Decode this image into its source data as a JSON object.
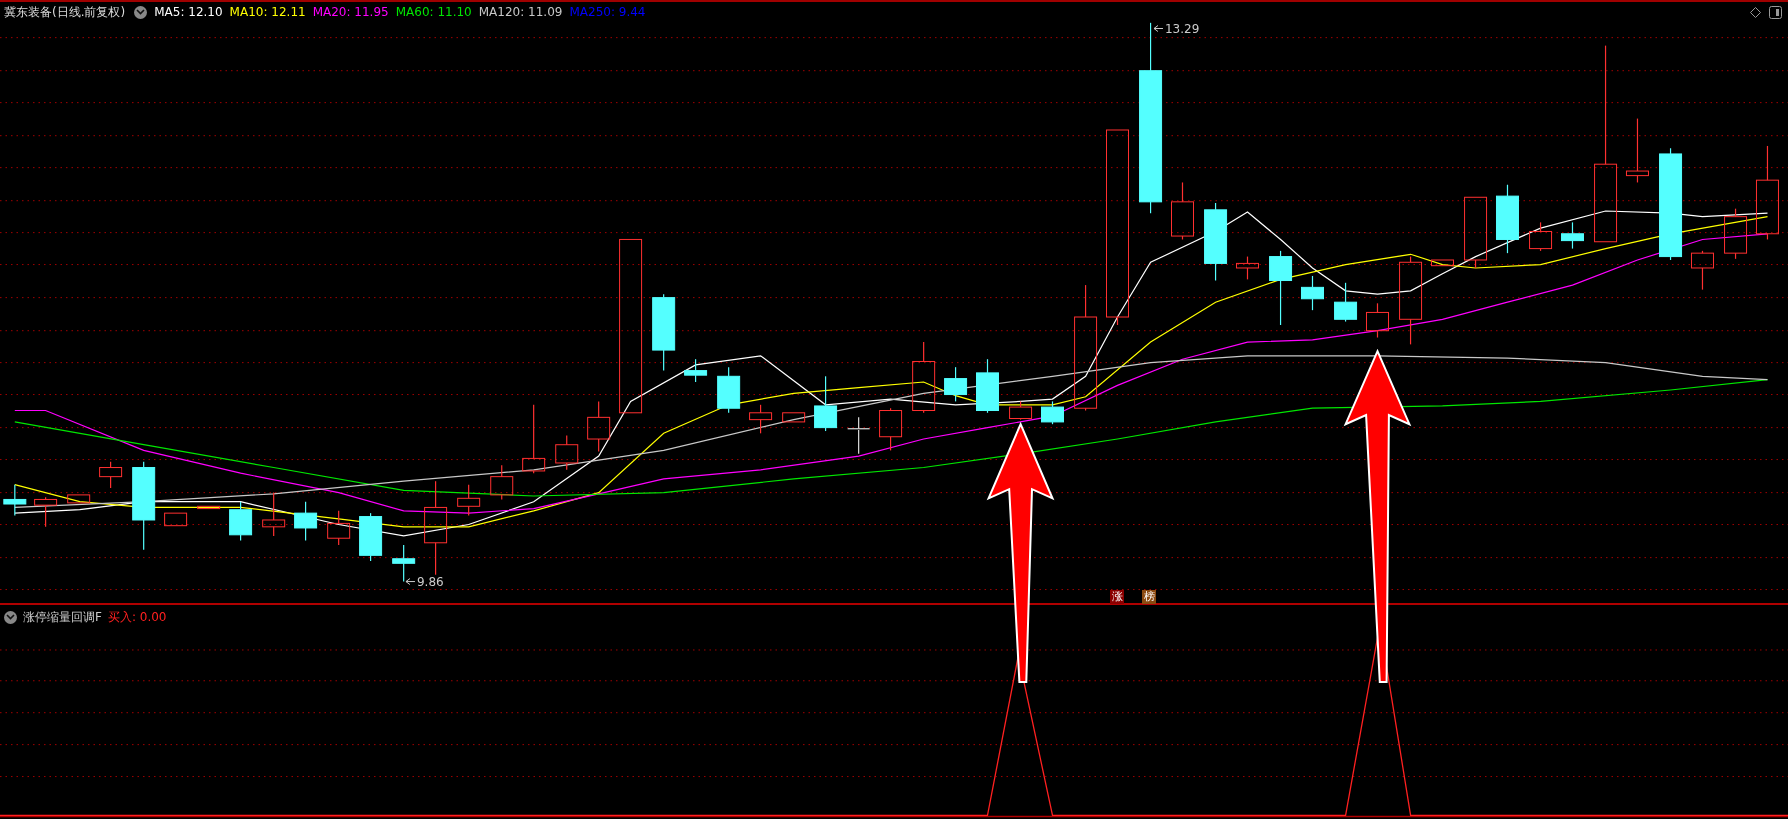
{
  "header": {
    "title": "冀东装备(日线.前复权)",
    "ma_legend": [
      {
        "label": "MA5: 12.10",
        "color": "#ffffff"
      },
      {
        "label": "MA10: 12.11",
        "color": "#ffff00"
      },
      {
        "label": "MA20: 11.95",
        "color": "#ff00ff"
      },
      {
        "label": "MA60: 11.10",
        "color": "#00e600"
      },
      {
        "label": "MA120: 11.09",
        "color": "#c8c8c8"
      },
      {
        "label": "MA250: 9.44",
        "color": "#0000ff"
      }
    ]
  },
  "price_chart": {
    "high_label": "13.29",
    "low_label": "9.86",
    "markers": [
      {
        "text": "涨",
        "color": "#8b0000"
      },
      {
        "text": "榜",
        "color": "#8b4a10"
      }
    ]
  },
  "indicator": {
    "name": "涨停缩量回调F",
    "reading": "买入: 0.00"
  }
}
